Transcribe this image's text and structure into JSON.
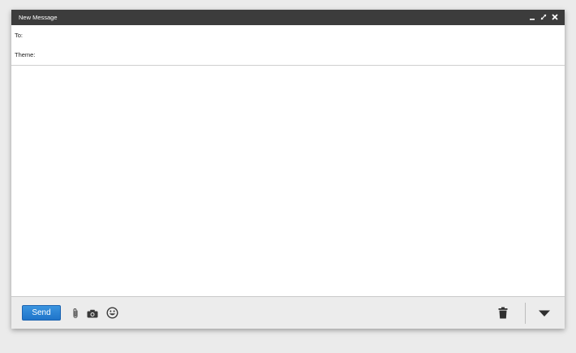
{
  "window": {
    "title": "New Message"
  },
  "fields": {
    "to_label": "To:",
    "to_value": "",
    "theme_label": "Theme:",
    "theme_value": ""
  },
  "message": {
    "body": ""
  },
  "toolbar": {
    "send_label": "Send",
    "icons": [
      "paperclip-icon",
      "camera-icon",
      "emoji-icon",
      "trash-icon",
      "chevron-down-icon"
    ]
  },
  "titlebar_icons": [
    "minimize-icon",
    "expand-icon",
    "close-icon"
  ],
  "colors": {
    "titlebar": "#3c3c3c",
    "send_button": "#1f74c9",
    "toolbar_bg": "#ececec",
    "page_bg": "#ebebeb"
  }
}
